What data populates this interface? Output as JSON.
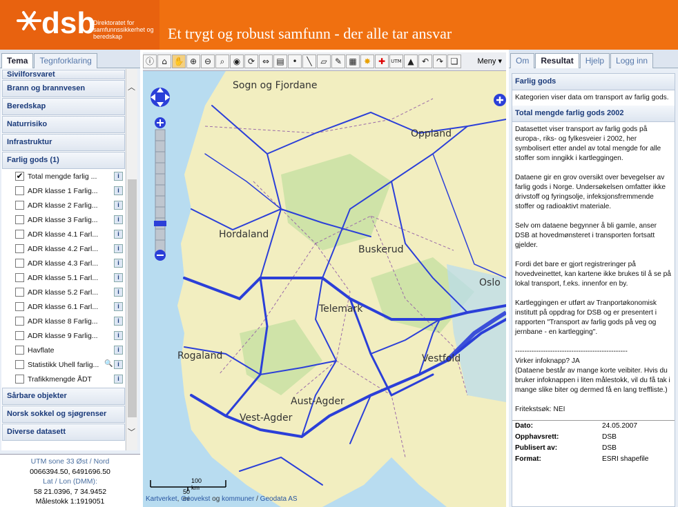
{
  "header": {
    "logo": "dsb",
    "org": "Direktoratet for samfunnssikkerhet og beredskap",
    "slogan": "Et trygt og robust samfunn - der alle tar ansvar"
  },
  "left": {
    "tabs": [
      "Tema",
      "Tegnforklaring"
    ],
    "categories_top": [
      "Sivilforsvaret",
      "Brann og brannvesen",
      "Beredskap",
      "Naturrisiko",
      "Infrastruktur",
      "Farlig gods (1)"
    ],
    "items": [
      {
        "label": "Total mengde farlig ...",
        "checked": true
      },
      {
        "label": "ADR klasse 1 Farlig..."
      },
      {
        "label": "ADR klasse 2 Farlig..."
      },
      {
        "label": "ADR klasse 3 Farlig..."
      },
      {
        "label": "ADR klasse 4.1 Farl..."
      },
      {
        "label": "ADR klasse 4.2 Farl..."
      },
      {
        "label": "ADR klasse 4.3 Farl..."
      },
      {
        "label": "ADR klasse 5.1 Farl..."
      },
      {
        "label": "ADR klasse 5.2 Farl..."
      },
      {
        "label": "ADR klasse 6.1 Farl..."
      },
      {
        "label": "ADR klasse 8 Farlig..."
      },
      {
        "label": "ADR klasse 9 Farlig..."
      },
      {
        "label": "Havflate"
      },
      {
        "label": "Statistikk Uhell farlig..."
      },
      {
        "label": "Trafikkmengde ÅDT"
      }
    ],
    "categories_bottom": [
      "Sårbare objekter",
      "Norsk sokkel og sjøgrenser",
      "Diverse datasett"
    ],
    "coords": {
      "utm_label": "UTM sone 33 Øst / Nord",
      "utm_value": "0066394.50, 6491696.50",
      "latlon_label": "Lat / Lon (DMM):",
      "latlon_value": "58 21.0396, 7 34.9452",
      "scale": "Målestokk 1:1919051"
    }
  },
  "map": {
    "menu": "Meny",
    "places": [
      "Sogn og Fjordane",
      "Oppland",
      "Hordaland",
      "Buskerud",
      "Oslo",
      "Telemark",
      "Rogaland",
      "Vestfold",
      "Aust-Agder",
      "Vest-Agder"
    ],
    "scale_km": "100 km",
    "scale_mi": "50 mi",
    "credit": {
      "a": "Kartverket",
      "b": "Geovekst",
      "c": "kommuner",
      "d": "Geodata AS",
      "sep1": ", ",
      "sep2": " og ",
      "sep3": " / "
    }
  },
  "right": {
    "tabs": [
      "Om",
      "Resultat",
      "Hjelp",
      "Logg inn"
    ],
    "section1": {
      "title": "Farlig gods",
      "text": "Kategorien viser data om transport av farlig gods."
    },
    "section2": {
      "title": "Total mengde farlig gods 2002",
      "paras": [
        "Datasettet viser transport av farlig gods på europa-, riks- og fylkesveier i 2002, her symbolisert etter andel av total mengde for alle stoffer som inngikk i kartleggingen.",
        "Dataene gir en grov oversikt over bevegelser av farlig gods i Norge. Undersøkelsen omfatter ikke drivstoff og fyringsolje, infeksjonsfremmende stoffer og radioaktivt materiale.",
        "Selv om dataene begynner å bli gamle, anser DSB at hovedmønsteret i transporten fortsatt gjelder.",
        "Fordi det bare er gjort registreringer på hovedveinettet, kan kartene ikke brukes til å se på lokal transport, f.eks. innenfor en by.",
        "Kartleggingen er utført av Tranportøkonomisk institutt på oppdrag for DSB og er presentert i rapporten \"Transport av farlig gods på veg og jernbane - en kartlegging\"."
      ],
      "dashes": "------------------------------------------------",
      "infoknapp": "Virker infoknapp? JA",
      "infonote": "(Dataene består av mange korte veibiter. Hvis du bruker infoknappen i liten målestokk, vil du få tak i mange slike biter og dermed få en lang treffliste.)",
      "fritekst": "Fritekstsøk: NEI",
      "meta": [
        [
          "Dato:",
          "24.05.2007"
        ],
        [
          "Opphavsrett:",
          "DSB"
        ],
        [
          "Publisert av:",
          "DSB"
        ],
        [
          "Format:",
          "ESRI shapefile"
        ]
      ]
    }
  },
  "colors": {
    "header": "#f07010",
    "route": "#2b3fd8",
    "land": "#f2eec0",
    "sea": "#b8dcf0"
  }
}
